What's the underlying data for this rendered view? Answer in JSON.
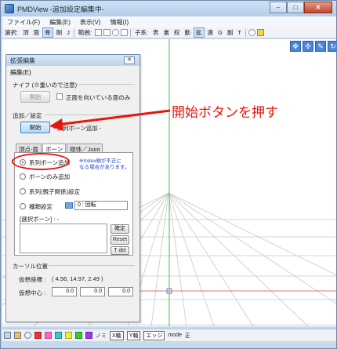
{
  "window": {
    "title": "PMDView -追加設定編集中-",
    "buttons": [
      "–",
      "□",
      "✕"
    ]
  },
  "menubar": [
    "ファイル(F)",
    "編集(E)",
    "表示(V)",
    "情報(I)"
  ],
  "toolbar": {
    "select_label": "選択:",
    "select_items": [
      "頂",
      "面",
      "骨",
      "剛",
      "J"
    ],
    "range_label": "範囲:",
    "child_label": "子系:",
    "child_items": [
      "表",
      "裏",
      "絞",
      "動",
      "拡",
      "連",
      "G",
      "副",
      "T"
    ]
  },
  "dialog": {
    "title": "拡張編集",
    "close": "✕",
    "menu": "編集(E)",
    "knife_group": "ナイフ (※重いので注意)",
    "knife_start": "開始",
    "knife_check": "正面を向いている面のみ",
    "add_group": "追加／設定",
    "add_start": "開始",
    "add_mode": "- 系列ボーン追加 -",
    "tabs": [
      "頂点-面",
      "ボーン",
      "剛体／Joint"
    ],
    "radios": [
      "系列ボーン追加",
      "ボーンのみ追加",
      "系列(親子関係)設定",
      "種類設定"
    ],
    "note": "※Index順が不正に\nなる場合があります。",
    "type_select": "0 : 回転",
    "selected_bone_label": "[選択ボーン] : -",
    "confirm_button": "確定",
    "reset_button": "Reset",
    "tdel_button": "T del",
    "cursor_group": "カーソル位置",
    "virtual_coord_label": "仮想座標 :",
    "virtual_coord_value": "( 4.56, 14.97, 2.49 )",
    "virtual_center_label": "仮想中心 :",
    "virtual_center_values": [
      "0.0",
      "0.0",
      "0.0"
    ]
  },
  "view_icons": [
    "✥",
    "✣",
    "✎",
    "↻"
  ],
  "statusbar": {
    "items": [
      "ノミ",
      "X軸",
      "Y軸",
      "エッジ",
      "mode",
      "正"
    ]
  },
  "annotation": {
    "text": "開始ボタンを押す"
  },
  "colors": {
    "annotation": "#e8150c",
    "axis_green": "#3cc43c",
    "axis_red": "#ee4444",
    "grid": "#c8c8c8"
  }
}
